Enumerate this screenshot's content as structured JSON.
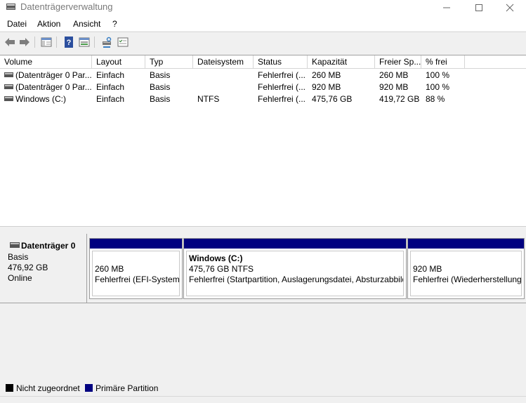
{
  "window": {
    "title": "Datenträgerverwaltung"
  },
  "menu": {
    "datei": "Datei",
    "aktion": "Aktion",
    "ansicht": "Ansicht",
    "help": "?"
  },
  "volume_table": {
    "headers": {
      "volume": "Volume",
      "layout": "Layout",
      "typ": "Typ",
      "dateisystem": "Dateisystem",
      "status": "Status",
      "kapazitaet": "Kapazität",
      "freier": "Freier Sp...",
      "frei": "% frei"
    },
    "rows": [
      {
        "volume": "(Datenträger 0 Par...",
        "layout": "Einfach",
        "typ": "Basis",
        "dateisystem": "",
        "status": "Fehlerfrei (...",
        "kapazitaet": "260 MB",
        "freier": "260 MB",
        "frei": "100 %"
      },
      {
        "volume": "(Datenträger 0 Par...",
        "layout": "Einfach",
        "typ": "Basis",
        "dateisystem": "",
        "status": "Fehlerfrei (...",
        "kapazitaet": "920 MB",
        "freier": "920 MB",
        "frei": "100 %"
      },
      {
        "volume": "Windows (C:)",
        "layout": "Einfach",
        "typ": "Basis",
        "dateisystem": "NTFS",
        "status": "Fehlerfrei (...",
        "kapazitaet": "475,76 GB",
        "freier": "419,72 GB",
        "frei": "88 %"
      }
    ]
  },
  "disk": {
    "name": "Datenträger 0",
    "type": "Basis",
    "size": "476,92 GB",
    "state": "Online",
    "partitions": [
      {
        "title": "",
        "size": "260 MB",
        "status": "Fehlerfrei (EFI-Systempartition)"
      },
      {
        "title": "Windows  (C:)",
        "size": "475,76 GB NTFS",
        "status": "Fehlerfrei (Startpartition, Auslagerungsdatei, Absturzabbild, Primäre Partition)"
      },
      {
        "title": "",
        "size": "920 MB",
        "status": "Fehlerfrei (Wiederherstellungspartition)"
      }
    ]
  },
  "legend": {
    "unallocated": {
      "label": "Nicht zugeordnet",
      "color": "#000000"
    },
    "primary": {
      "label": "Primäre Partition",
      "color": "#000080"
    }
  }
}
